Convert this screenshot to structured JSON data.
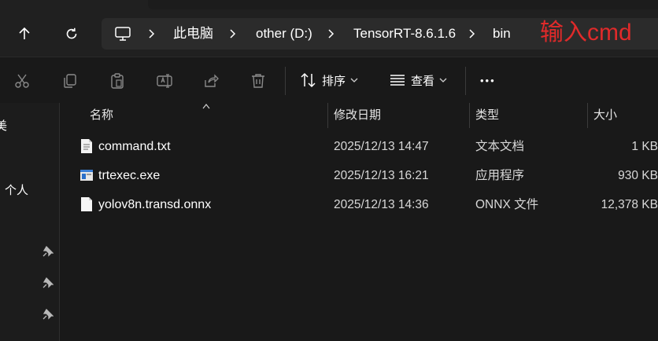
{
  "address_bar": {
    "crumbs": [
      "此电脑",
      "other (D:)",
      "TensorRT-8.6.1.6",
      "bin"
    ]
  },
  "annotation": {
    "text": "输入cmd",
    "color": "#e02a2a"
  },
  "toolbar": {
    "sort_label": "排序",
    "view_label": "查看",
    "more_label": "•••"
  },
  "sidebar": {
    "partial_label_1": "美",
    "partial_label_2": "个人"
  },
  "columns": {
    "name": "名称",
    "date": "修改日期",
    "type": "类型",
    "size": "大小"
  },
  "files": [
    {
      "name": "command.txt",
      "date": "2025/12/13 14:47",
      "type": "文本文档",
      "size": "1 KB",
      "icon": "text-file-icon"
    },
    {
      "name": "trtexec.exe",
      "date": "2025/12/13 16:21",
      "type": "应用程序",
      "size": "930 KB",
      "icon": "executable-file-icon"
    },
    {
      "name": "yolov8n.transd.onnx",
      "date": "2025/12/13 14:36",
      "type": "ONNX 文件",
      "size": "12,378 KB",
      "icon": "generic-file-icon"
    }
  ]
}
